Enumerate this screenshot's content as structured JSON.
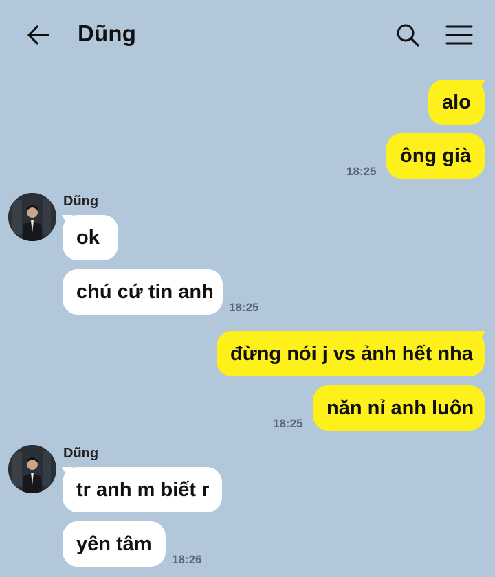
{
  "header": {
    "title": "Dũng",
    "back_icon": "arrow-left-icon",
    "search_icon": "search-icon",
    "menu_icon": "hamburger-menu-icon"
  },
  "colors": {
    "background": "#b2c7da",
    "outgoing_bubble": "#fef01b",
    "incoming_bubble": "#ffffff",
    "timestamp": "#5c6670"
  },
  "messages": {
    "m1": {
      "text": "alo"
    },
    "m2": {
      "text": "ông già",
      "time": "18:25"
    },
    "g1": {
      "sender": "Dũng"
    },
    "m3": {
      "text": "ok"
    },
    "m4": {
      "text": "chú cứ tin anh",
      "time": "18:25"
    },
    "m5": {
      "text": "đừng nói j vs ảnh hết nha"
    },
    "m6": {
      "text": "năn nỉ anh luôn",
      "time": "18:25"
    },
    "g2": {
      "sender": "Dũng"
    },
    "m7": {
      "text": "tr anh m biết r"
    },
    "m8": {
      "text": "yên tâm",
      "time": "18:26"
    }
  }
}
